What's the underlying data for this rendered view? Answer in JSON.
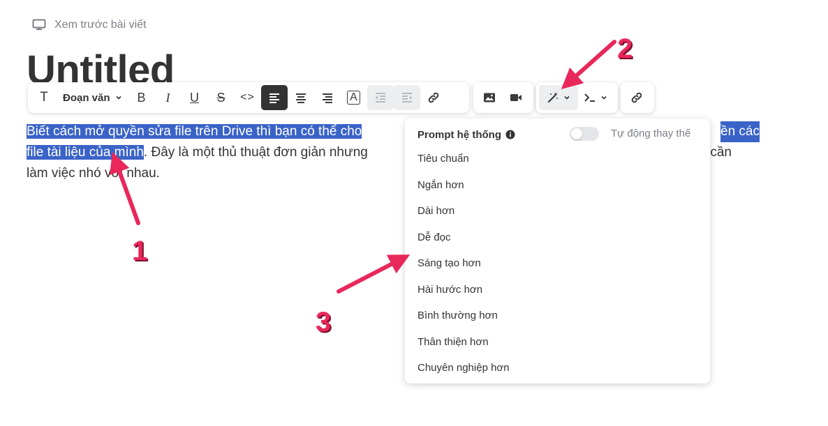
{
  "header": {
    "preview_label": "Xem trước bài viết",
    "preview_icon": "monitor-icon"
  },
  "document": {
    "title": "Untitled",
    "line1_selected_left": "Biết cách mở quyền sửa file trên Drive thì bạn có thể cho",
    "line1_selected_right": "ền các",
    "line2_selected": "file tài liệu của mình",
    "line2_rest": ". Đây là một thủ thuật đơn giản nhưng",
    "line2_tail": "hi cần",
    "line3": "làm việc nhó    với nhau."
  },
  "toolbar": {
    "text_style_icon": "T",
    "paragraph_label": "Đoạn văn",
    "bold": "B",
    "italic": "I",
    "underline": "U",
    "strike": "S",
    "code": "<>",
    "font_color": "A"
  },
  "ai_menu": {
    "header_label": "Prompt hệ thống",
    "auto_replace_label": "Tự động thay thế",
    "auto_replace_on": false,
    "items": [
      "Tiêu chuẩn",
      "Ngắn hơn",
      "Dài hơn",
      "Dễ đọc",
      "Sáng tạo hơn",
      "Hài hước hơn",
      "Bình thường hơn",
      "Thân thiện hơn",
      "Chuyên nghiệp hơn"
    ]
  },
  "annotations": {
    "n1": "1",
    "n2": "2",
    "n3": "3"
  },
  "colors": {
    "selection": "#3a63c8",
    "annotation": "#e8285a",
    "active_button": "#333333"
  }
}
